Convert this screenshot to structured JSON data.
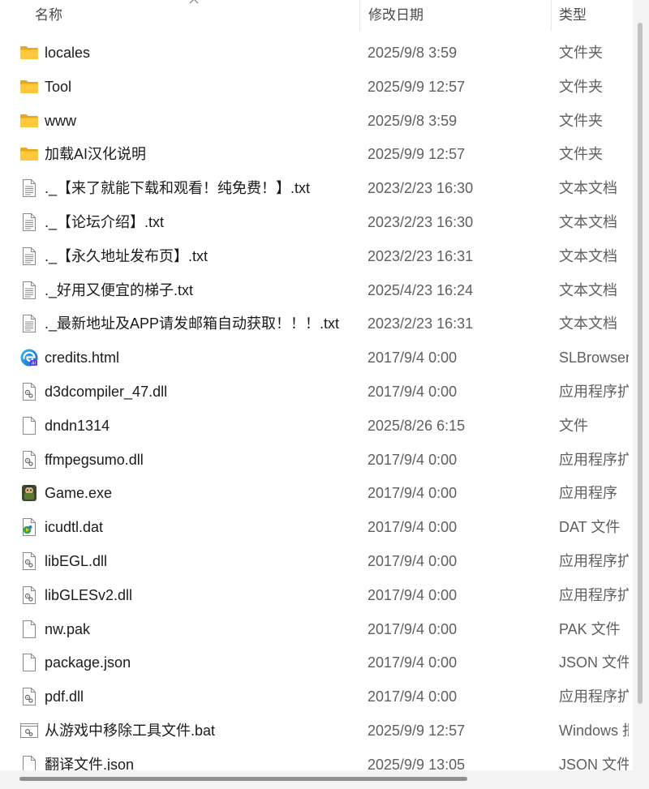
{
  "columns": {
    "name": "名称",
    "date": "修改日期",
    "type": "类型"
  },
  "files": [
    {
      "icon": "folder-icon",
      "name": "locales",
      "date": "2025/9/8 3:59",
      "type": "文件夹"
    },
    {
      "icon": "folder-icon",
      "name": "Tool",
      "date": "2025/9/9 12:57",
      "type": "文件夹"
    },
    {
      "icon": "folder-icon",
      "name": "www",
      "date": "2025/9/8 3:59",
      "type": "文件夹"
    },
    {
      "icon": "folder-icon",
      "name": "加载AI汉化说明",
      "date": "2025/9/9 12:57",
      "type": "文件夹"
    },
    {
      "icon": "text-file-icon",
      "name": "._【来了就能下载和观看！纯免费！】.txt",
      "date": "2023/2/23 16:30",
      "type": "文本文档"
    },
    {
      "icon": "text-file-icon",
      "name": "._【论坛介绍】.txt",
      "date": "2023/2/23 16:30",
      "type": "文本文档"
    },
    {
      "icon": "text-file-icon",
      "name": "._【永久地址发布页】.txt",
      "date": "2023/2/23 16:31",
      "type": "文本文档"
    },
    {
      "icon": "text-file-icon",
      "name": "._好用又便宜的梯子.txt",
      "date": "2025/4/23 16:24",
      "type": "文本文档"
    },
    {
      "icon": "text-file-icon",
      "name": "._最新地址及APP请发邮箱自动获取！！！.txt",
      "date": "2023/2/23 16:31",
      "type": "文本文档"
    },
    {
      "icon": "browser-file-icon",
      "name": "credits.html",
      "date": "2017/9/4 0:00",
      "type": "SLBrowser"
    },
    {
      "icon": "dll-file-icon",
      "name": "d3dcompiler_47.dll",
      "date": "2017/9/4 0:00",
      "type": "应用程序扩"
    },
    {
      "icon": "blank-file-icon",
      "name": "dndn1314",
      "date": "2025/8/26 6:15",
      "type": "文件"
    },
    {
      "icon": "dll-file-icon",
      "name": "ffmpegsumo.dll",
      "date": "2017/9/4 0:00",
      "type": "应用程序扩"
    },
    {
      "icon": "game-exe-icon",
      "name": "Game.exe",
      "date": "2017/9/4 0:00",
      "type": "应用程序"
    },
    {
      "icon": "media-file-icon",
      "name": "icudtl.dat",
      "date": "2017/9/4 0:00",
      "type": "DAT 文件"
    },
    {
      "icon": "dll-file-icon",
      "name": "libEGL.dll",
      "date": "2017/9/4 0:00",
      "type": "应用程序扩"
    },
    {
      "icon": "dll-file-icon",
      "name": "libGLESv2.dll",
      "date": "2017/9/4 0:00",
      "type": "应用程序扩"
    },
    {
      "icon": "blank-file-icon",
      "name": "nw.pak",
      "date": "2017/9/4 0:00",
      "type": "PAK 文件"
    },
    {
      "icon": "blank-file-icon",
      "name": "package.json",
      "date": "2017/9/4 0:00",
      "type": "JSON 文件"
    },
    {
      "icon": "dll-file-icon",
      "name": "pdf.dll",
      "date": "2017/9/4 0:00",
      "type": "应用程序扩"
    },
    {
      "icon": "batch-file-icon",
      "name": "从游戏中移除工具文件.bat",
      "date": "2025/9/9 12:57",
      "type": "Windows 批"
    },
    {
      "icon": "blank-file-icon",
      "name": "翻译文件.json",
      "date": "2025/9/9 13:05",
      "type": "JSON 文件"
    }
  ]
}
